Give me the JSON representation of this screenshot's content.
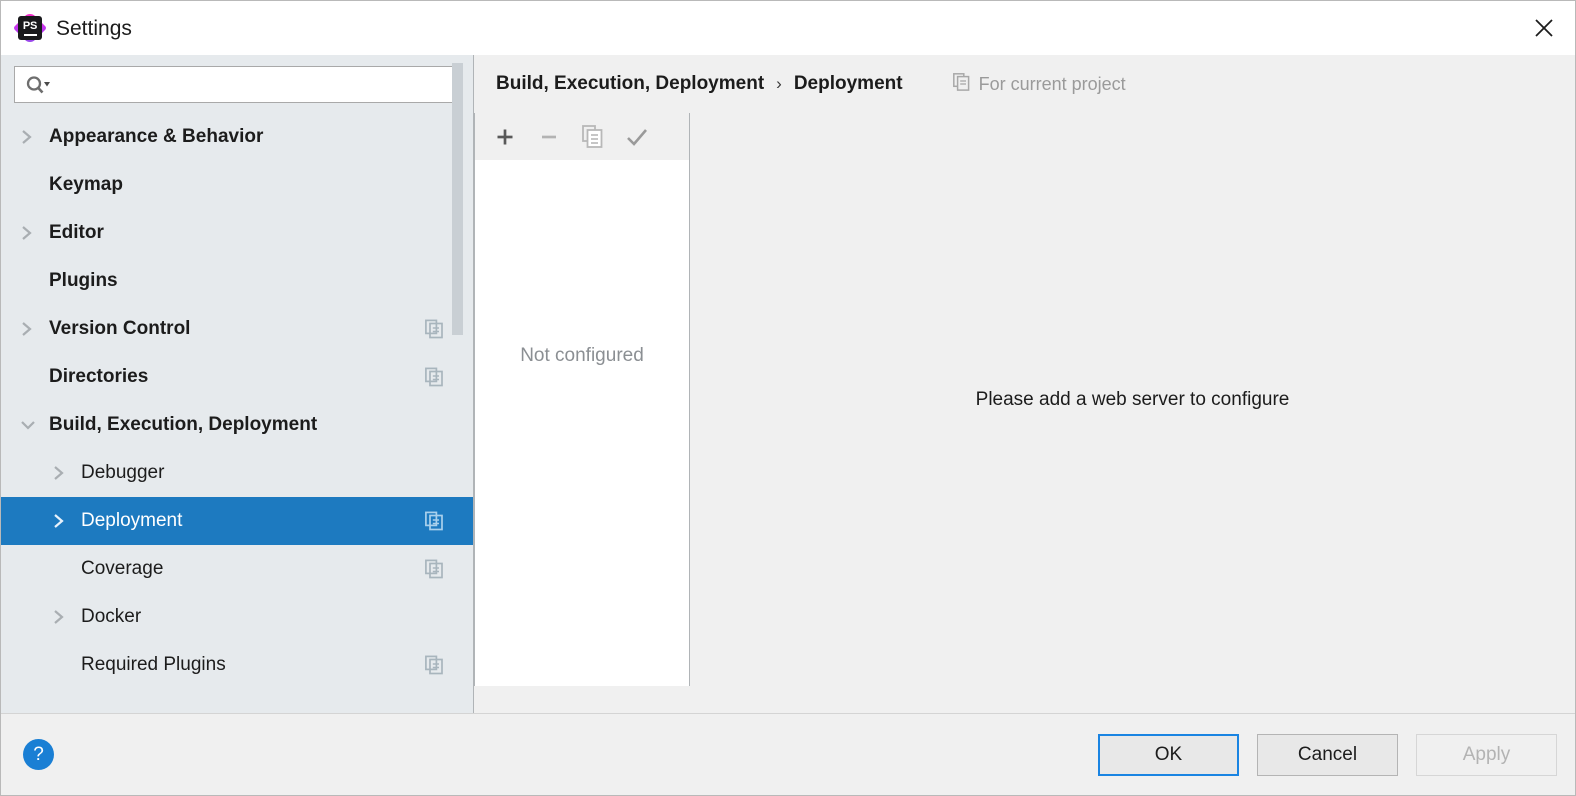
{
  "window": {
    "title": "Settings",
    "app_icon": "phpstorm-ps-logo",
    "close_icon": "close-icon"
  },
  "search": {
    "value": "",
    "placeholder": "",
    "icon": "search-icon",
    "dropdown_icon": "chevron-down-icon"
  },
  "sidebar": {
    "items": [
      {
        "label": "Appearance & Behavior",
        "level": 1,
        "bold": true,
        "twisty": "collapsed",
        "project_icon": false,
        "selected": false
      },
      {
        "label": "Keymap",
        "level": 1,
        "bold": true,
        "twisty": "none",
        "project_icon": false,
        "selected": false
      },
      {
        "label": "Editor",
        "level": 1,
        "bold": true,
        "twisty": "collapsed",
        "project_icon": false,
        "selected": false
      },
      {
        "label": "Plugins",
        "level": 1,
        "bold": true,
        "twisty": "none",
        "project_icon": false,
        "selected": false
      },
      {
        "label": "Version Control",
        "level": 1,
        "bold": true,
        "twisty": "collapsed",
        "project_icon": true,
        "selected": false
      },
      {
        "label": "Directories",
        "level": 1,
        "bold": true,
        "twisty": "none",
        "project_icon": true,
        "selected": false
      },
      {
        "label": "Build, Execution, Deployment",
        "level": 1,
        "bold": true,
        "twisty": "expanded",
        "project_icon": false,
        "selected": false
      },
      {
        "label": "Debugger",
        "level": 2,
        "bold": false,
        "twisty": "collapsed",
        "project_icon": false,
        "selected": false
      },
      {
        "label": "Deployment",
        "level": 2,
        "bold": false,
        "twisty": "collapsed",
        "project_icon": true,
        "selected": true
      },
      {
        "label": "Coverage",
        "level": 2,
        "bold": false,
        "twisty": "none",
        "project_icon": true,
        "selected": false
      },
      {
        "label": "Docker",
        "level": 2,
        "bold": false,
        "twisty": "collapsed",
        "project_icon": false,
        "selected": false
      },
      {
        "label": "Required Plugins",
        "level": 2,
        "bold": false,
        "twisty": "none",
        "project_icon": true,
        "selected": false
      }
    ],
    "selection_color": "#1d7ac0",
    "background_color": "#e6eaed"
  },
  "breadcrumb": {
    "parent": "Build, Execution, Deployment",
    "separator": "›",
    "current": "Deployment",
    "for_current_project": "For current project",
    "for_current_project_icon": "copy-project-icon"
  },
  "list_toolbar": {
    "buttons": [
      {
        "name": "add-server-button",
        "icon": "plus-icon",
        "enabled": true
      },
      {
        "name": "remove-server-button",
        "icon": "minus-icon",
        "enabled": false
      },
      {
        "name": "copy-server-button",
        "icon": "copy-icon",
        "enabled": false
      },
      {
        "name": "set-default-button",
        "icon": "checkmark-icon",
        "enabled": false
      }
    ]
  },
  "server_list": {
    "empty_text": "Not configured",
    "items": []
  },
  "detail": {
    "message": "Please add a web server to configure"
  },
  "footer": {
    "help_icon": "question-mark-icon",
    "help_label": "?",
    "ok_label": "OK",
    "cancel_label": "Cancel",
    "apply_label": "Apply",
    "apply_enabled": false,
    "focus_color": "#1a84e2"
  }
}
